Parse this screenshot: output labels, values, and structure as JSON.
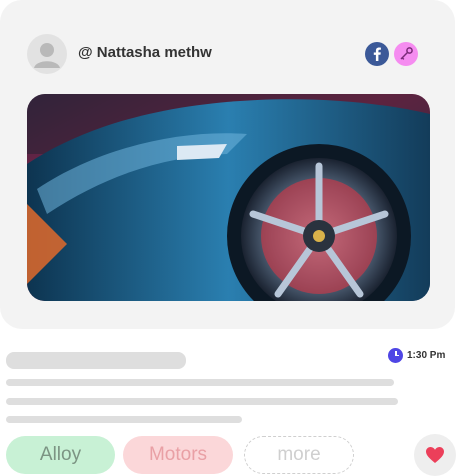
{
  "post": {
    "username": "@ Nattasha methw",
    "time": "1:30 Pm"
  },
  "tags": [
    {
      "label": "Alloy",
      "color": "#c8f1d5"
    },
    {
      "label": "Motors",
      "color": "#fbd7d9"
    },
    {
      "label": "more"
    }
  ],
  "icons": {
    "social_1": "facebook-icon",
    "social_2": "key-icon",
    "time": "clock-icon",
    "like": "heart-icon"
  },
  "colors": {
    "card_bg": "#f3f3f3",
    "facebook": "#3b5998",
    "key_badge": "#f58cf0",
    "clock": "#4f46e5",
    "heart": "#ec3f5a",
    "placeholder": "#dedede"
  }
}
